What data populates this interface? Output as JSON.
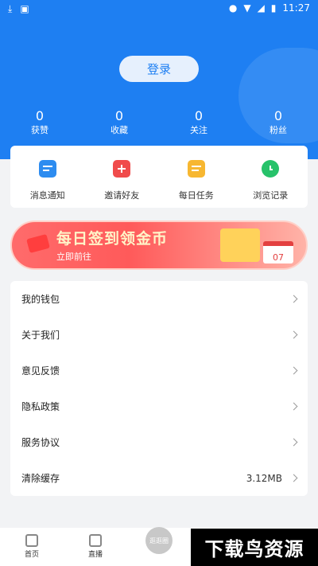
{
  "status_bar": {
    "time": "11:27"
  },
  "header": {
    "login_label": "登录"
  },
  "stats": [
    {
      "value": "0",
      "label": "获赞"
    },
    {
      "value": "0",
      "label": "收藏"
    },
    {
      "value": "0",
      "label": "关注"
    },
    {
      "value": "0",
      "label": "粉丝"
    }
  ],
  "quick_actions": [
    {
      "label": "消息通知",
      "icon": "message-icon",
      "color": "#2d8cf0"
    },
    {
      "label": "邀请好友",
      "icon": "invite-gift-icon",
      "color": "#f04b4b"
    },
    {
      "label": "每日任务",
      "icon": "task-list-icon",
      "color": "#f7b731"
    },
    {
      "label": "浏览记录",
      "icon": "clock-icon",
      "color": "#27c26a"
    }
  ],
  "banner": {
    "title": "每日签到领金币",
    "subtitle": "立即前往",
    "calendar_day": "07"
  },
  "menu": [
    {
      "label": "我的钱包",
      "value": ""
    },
    {
      "label": "关于我们",
      "value": ""
    },
    {
      "label": "意见反馈",
      "value": ""
    },
    {
      "label": "隐私政策",
      "value": ""
    },
    {
      "label": "服务协议",
      "value": ""
    },
    {
      "label": "清除缓存",
      "value": "3.12MB"
    }
  ],
  "tabbar": {
    "home": "首页",
    "live": "直播",
    "center": "逛逛圈"
  },
  "watermark": "下载鸟资源"
}
